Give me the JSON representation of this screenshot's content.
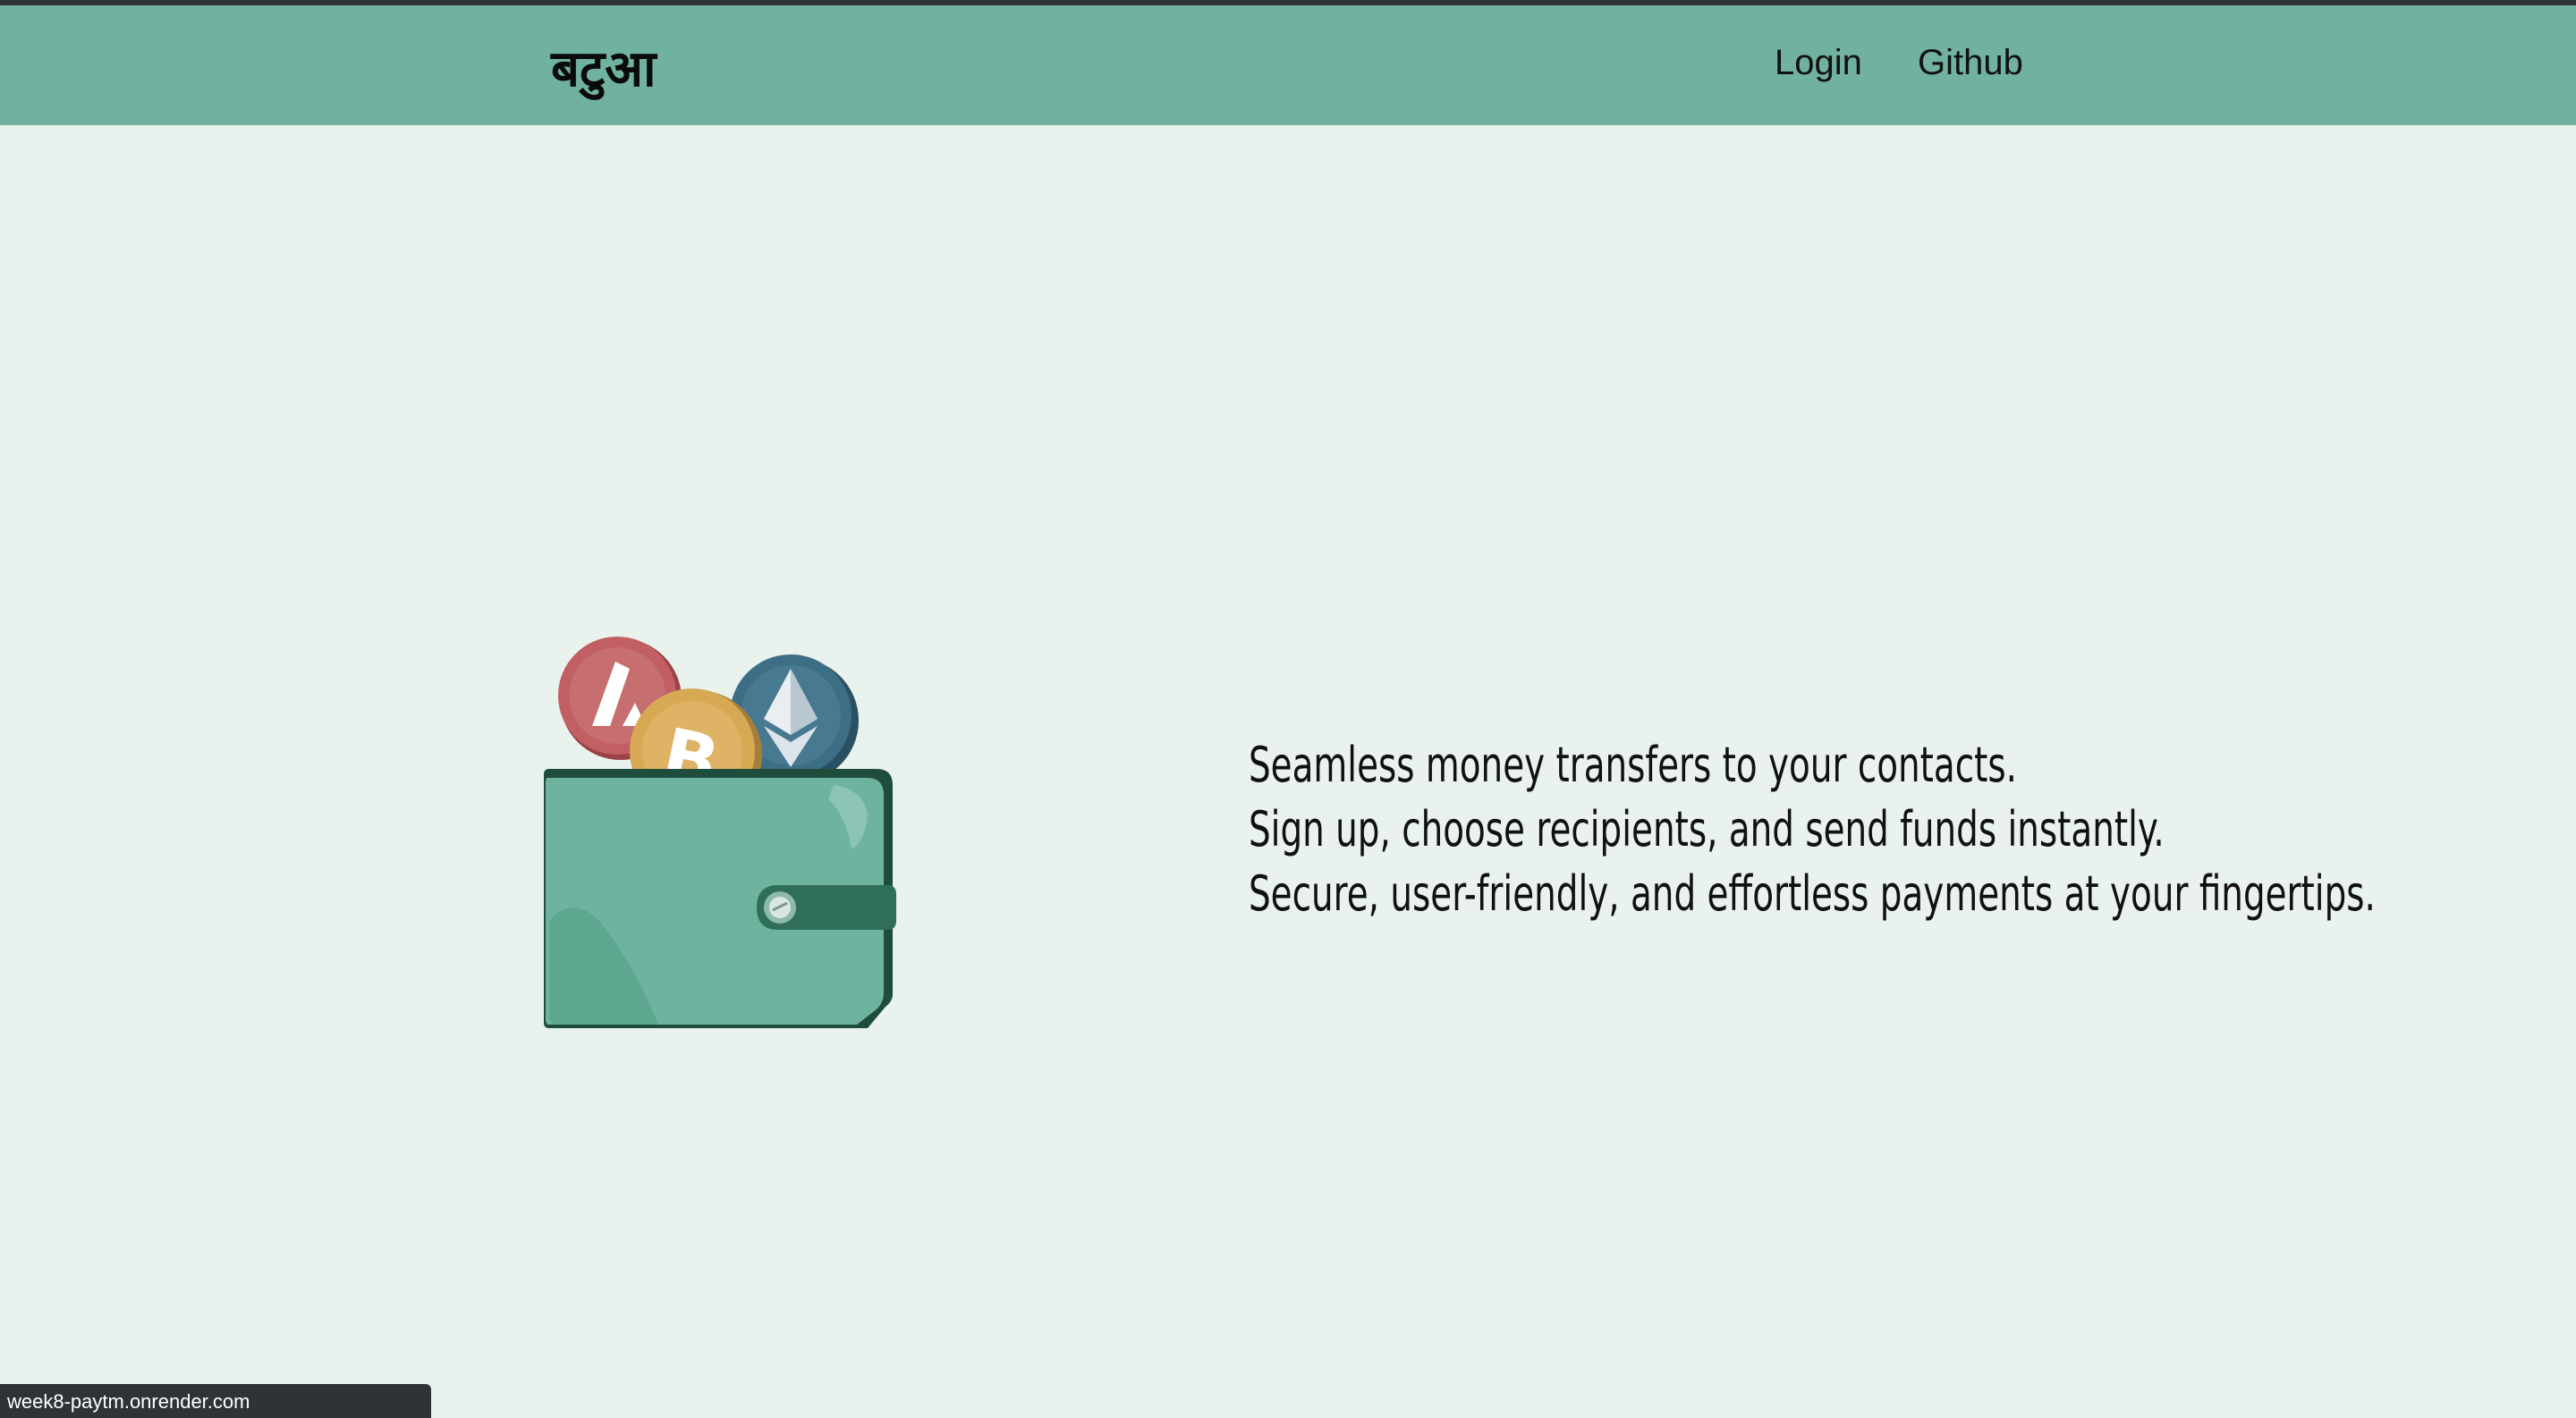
{
  "navbar": {
    "brand": "बटुआ",
    "links": [
      {
        "label": "Login"
      },
      {
        "label": "Github"
      }
    ]
  },
  "hero": {
    "illustration": {
      "icon": "wallet-with-crypto-coins-icon",
      "coins": [
        "avalanche-coin-icon",
        "bitcoin-coin-icon",
        "ethereum-coin-icon"
      ]
    },
    "tagline": [
      "Seamless money transfers to your contacts.",
      "Sign up, choose recipients, and send funds instantly.",
      "Secure, user-friendly, and effortless payments at your fingertips."
    ]
  },
  "status_bar": {
    "url": "week8-paytm.onrender.com"
  },
  "colors": {
    "navbar": "#71b1a0",
    "background": "#e9f2ed",
    "wallet": "#6eb3a0",
    "wallet_dark": "#2f6e57",
    "avalanche": "#c15f63",
    "bitcoin": "#d8a955",
    "ethereum": "#3c6e86"
  }
}
